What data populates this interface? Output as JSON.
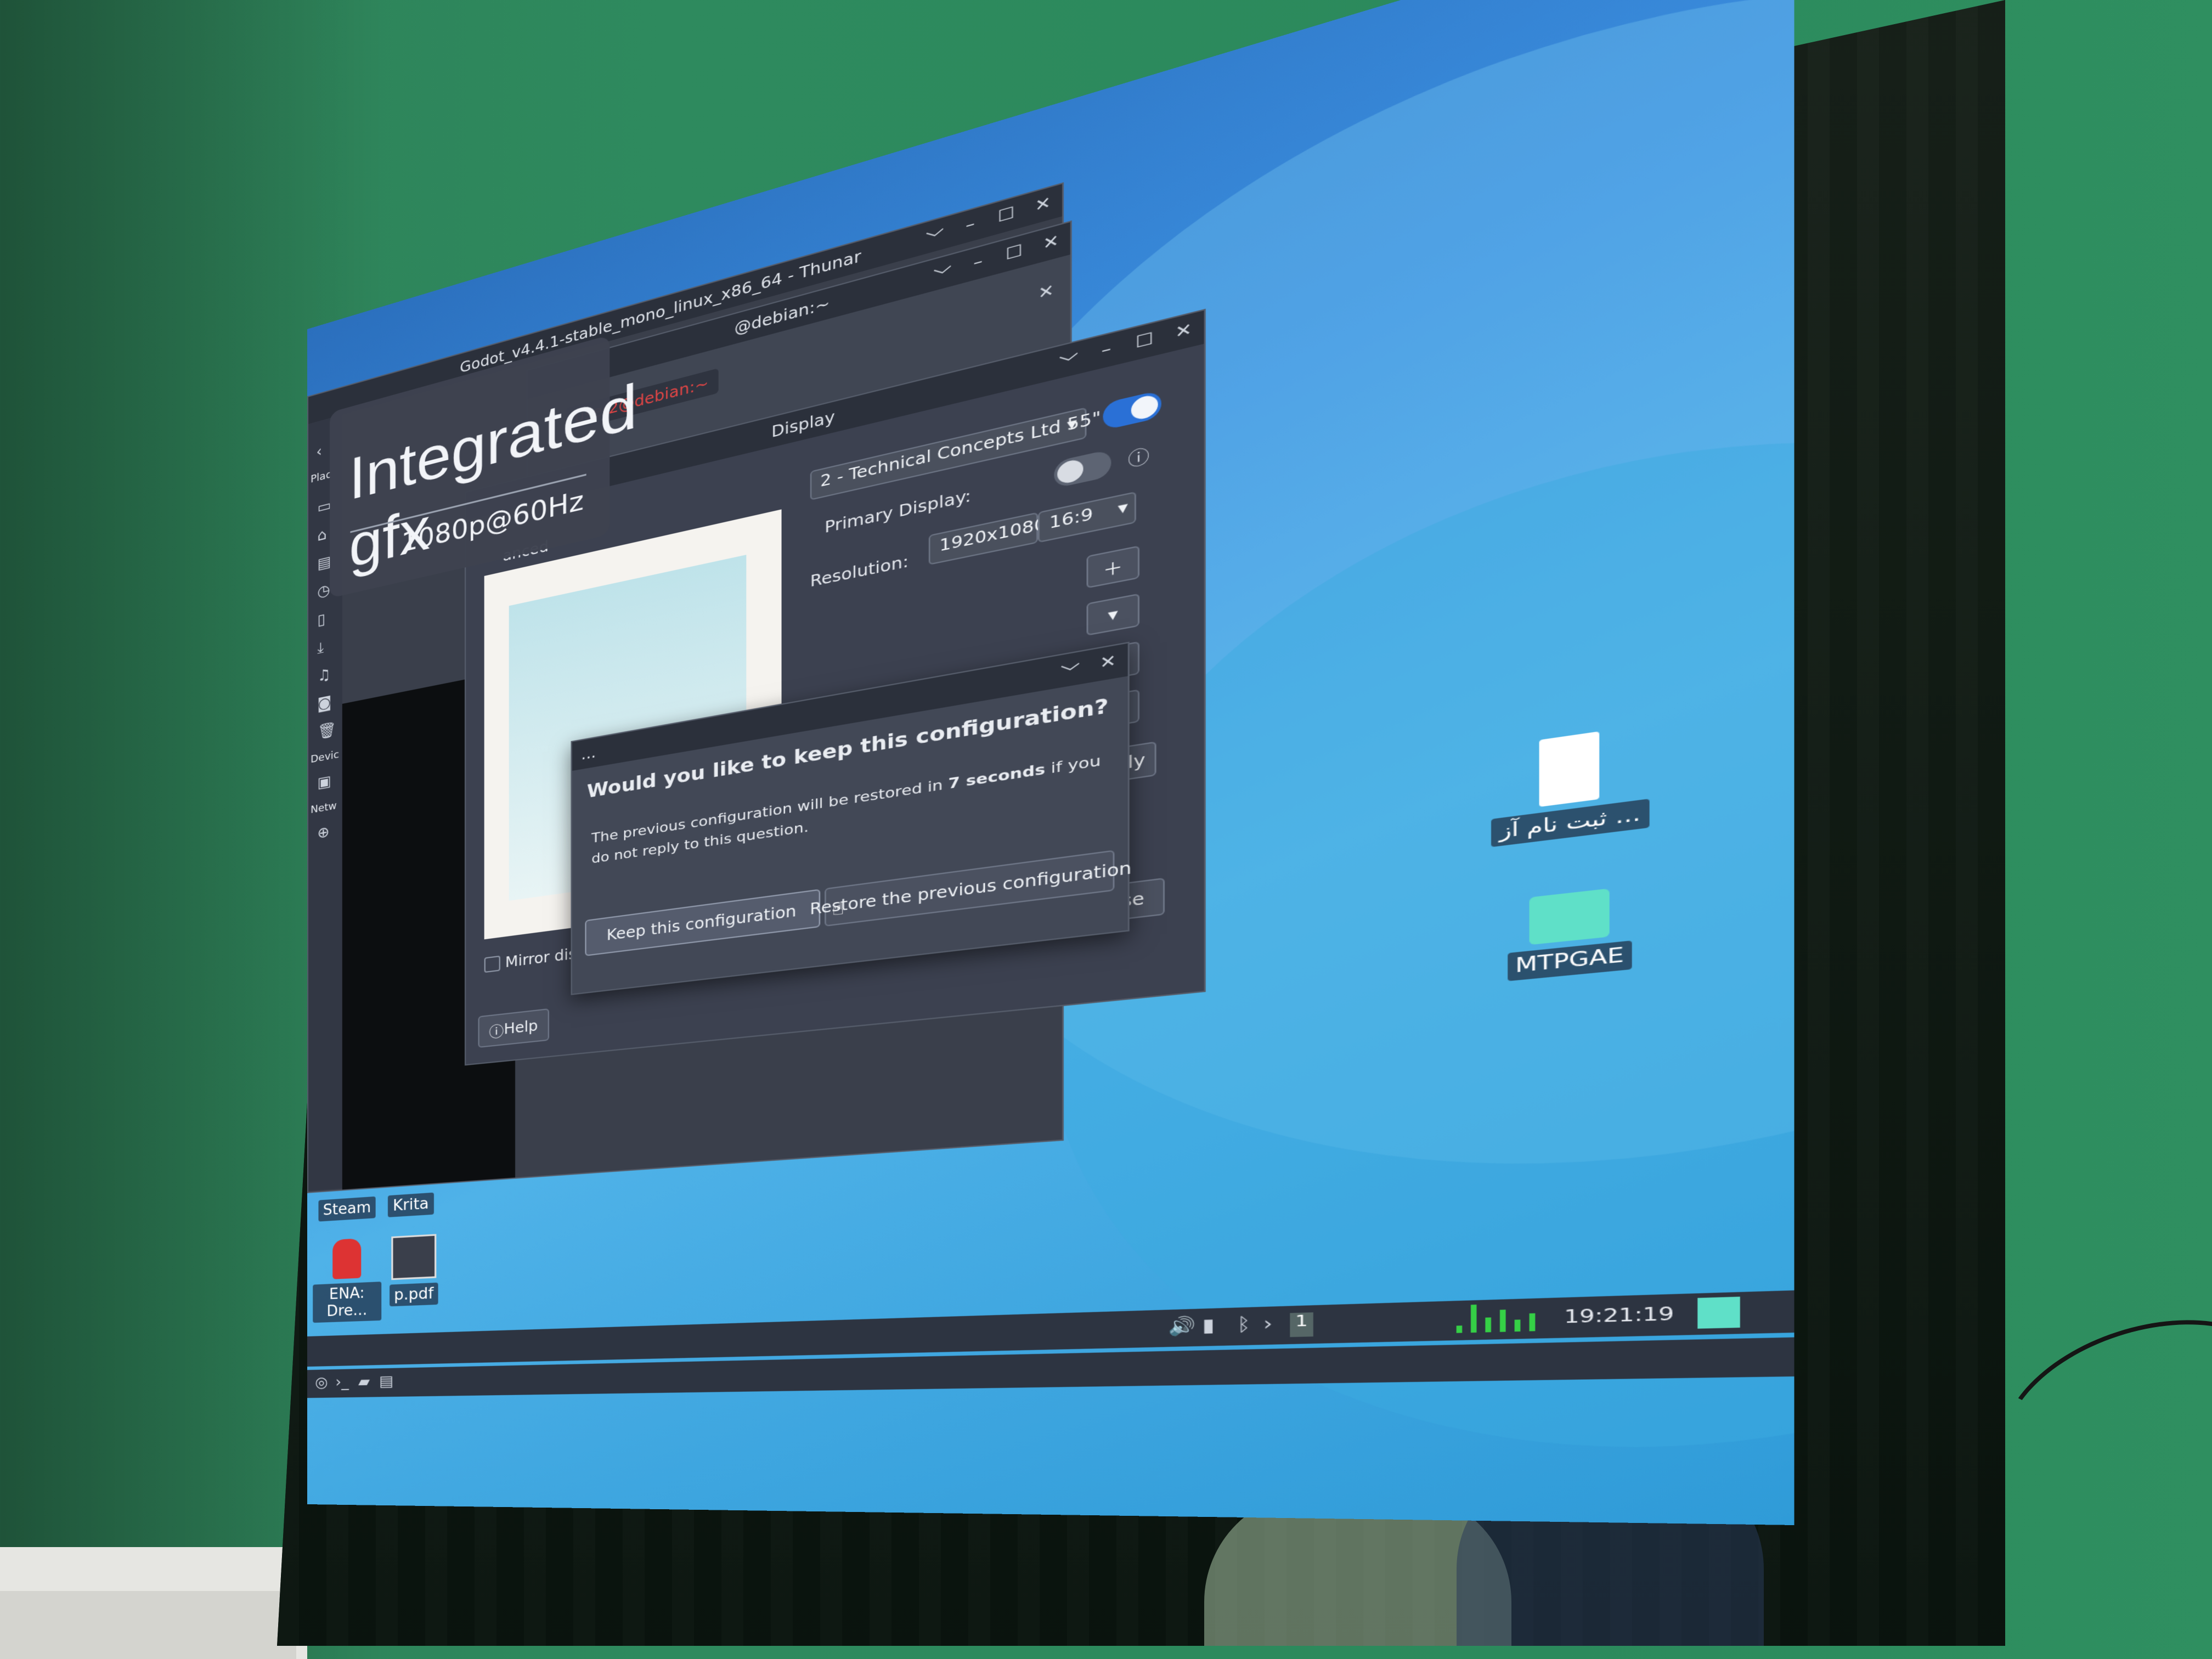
{
  "osd": {
    "title": "Integrated gfx",
    "mode": "1080p@60Hz"
  },
  "godot_window": {
    "title": "Godot_v4.4.1-stable_mono_linux_x86_64 - Thunar"
  },
  "terminal_window": {
    "title": "@debian:~",
    "prompt": "user2@debian:~"
  },
  "display_window": {
    "title": "Display",
    "advanced_tab": "anced",
    "monitor_select": "2 - Technical Concepts Ltd 55\"",
    "primary_display_label": "Primary Display:",
    "resolution_label": "Resolution:",
    "resolution_value": "1920x1080",
    "aspect_value": "16:9",
    "mirror_label": "Mirror displays",
    "apply_label": "Apply",
    "close_label": "Close",
    "help_label": "Help"
  },
  "confirm_dialog": {
    "question": "Would you like to keep this configuration?",
    "message_part1": "The previous configuration will be restored in ",
    "message_bold": "7 seconds",
    "message_part2": " if you do not reply to this question.",
    "keep_label": "Keep this configuration",
    "restore_label": "Restore the previous configuration",
    "dots": "..."
  },
  "sidebar": {
    "places": "Plac",
    "devices": "Devic",
    "network": "Netw"
  },
  "desktop_icons": [
    {
      "label": "ثبت نام آز ...",
      "icon": "document-icon"
    },
    {
      "label": "MTPGAE",
      "icon": "folder-icon"
    },
    {
      "label": "Steam",
      "icon": "steam-icon"
    },
    {
      "label": "Krita",
      "icon": "krita-icon"
    },
    {
      "label": "ENA: Dre...",
      "icon": "app-icon"
    },
    {
      "label": "p.pdf",
      "icon": "pdf-icon"
    }
  ],
  "panel": {
    "clock": "19:21:19",
    "workspace": "1",
    "search_partial": "ed"
  },
  "colors": {
    "accent": "#2a70d6",
    "desktop": "#3b8fe0",
    "wall": "#2e8a5e",
    "graph": "#35d046"
  }
}
